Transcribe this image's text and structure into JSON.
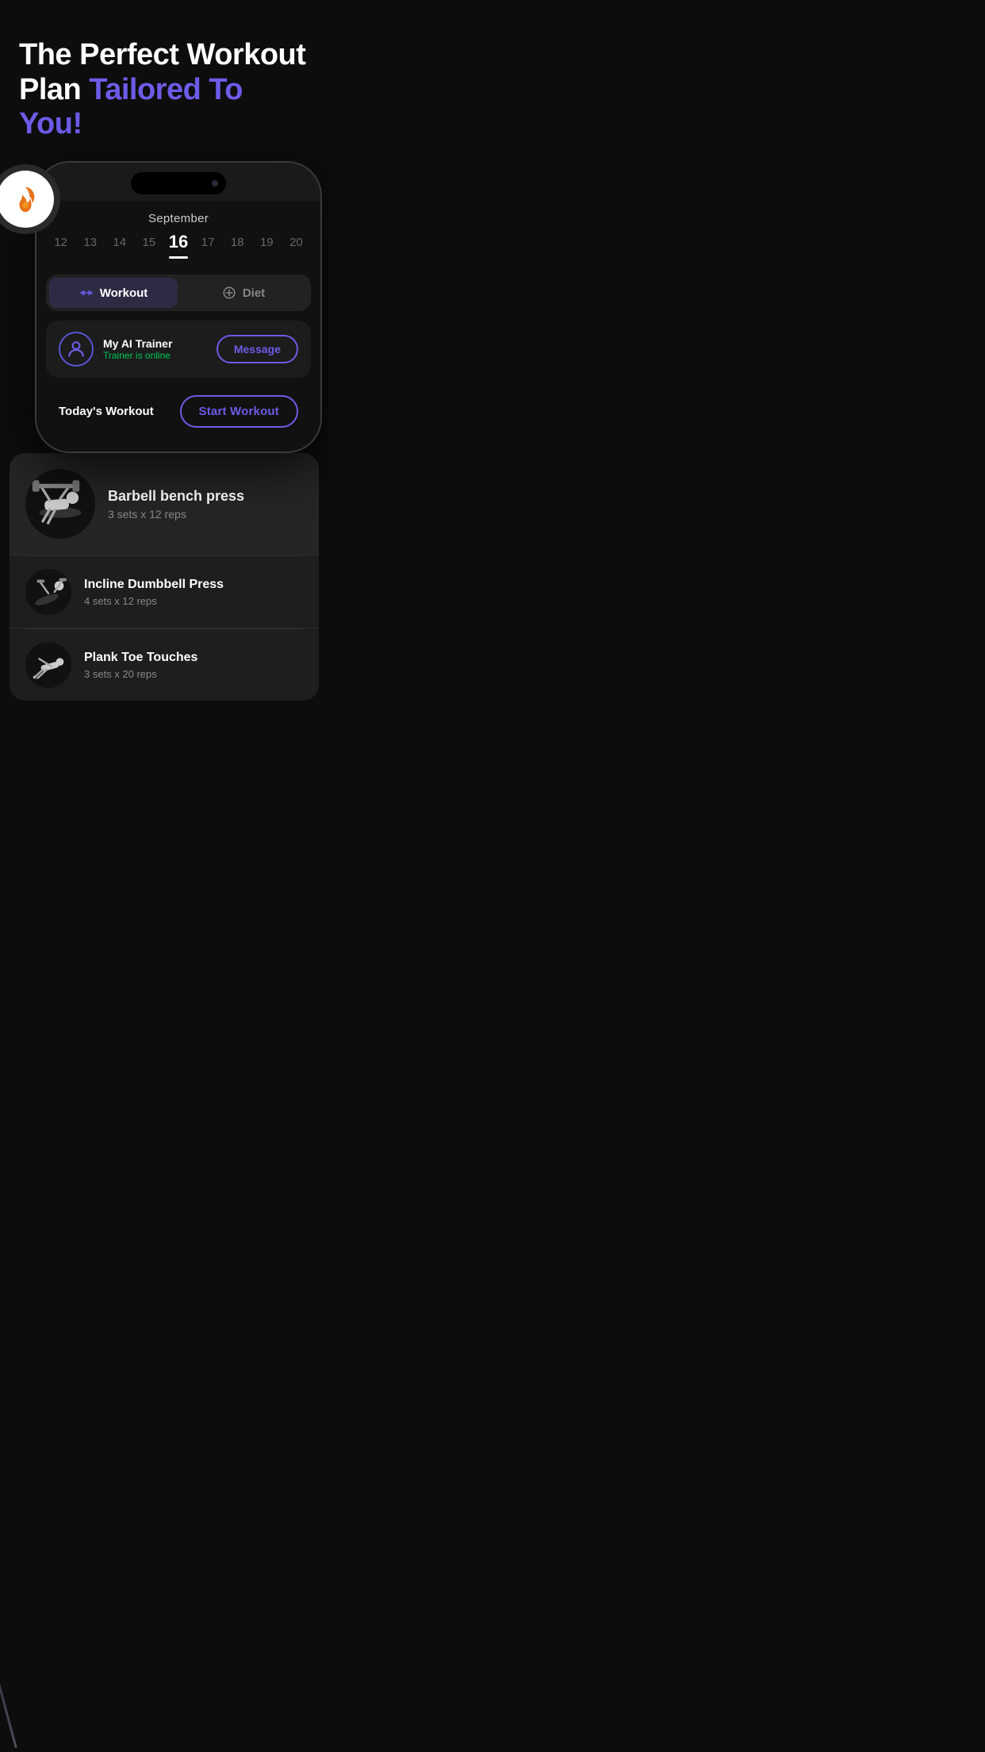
{
  "hero": {
    "title_line1": "The Perfect Workout",
    "title_line2_white": "Plan ",
    "title_line2_accent": "Tailored To You!"
  },
  "calendar": {
    "month": "September",
    "dates": [
      {
        "num": "12",
        "active": false
      },
      {
        "num": "13",
        "active": false
      },
      {
        "num": "14",
        "active": false
      },
      {
        "num": "15",
        "active": false
      },
      {
        "num": "16",
        "active": true
      },
      {
        "num": "17",
        "active": false
      },
      {
        "num": "18",
        "active": false
      },
      {
        "num": "19",
        "active": false
      },
      {
        "num": "20",
        "active": false
      }
    ]
  },
  "tabs": {
    "workout_label": "Workout",
    "diet_label": "Diet"
  },
  "trainer": {
    "name": "My AI Trainer",
    "status": "Trainer is online",
    "message_btn": "Message"
  },
  "workout": {
    "todays_label": "Today's Workout",
    "start_btn": "Start Workout"
  },
  "exercises": [
    {
      "name": "Barbell bench press",
      "sets": "3 sets x 12 reps",
      "featured": true
    },
    {
      "name": "Incline Dumbbell Press",
      "sets": "4 sets x 12 reps",
      "featured": false
    },
    {
      "name": "Plank Toe Touches",
      "sets": "3 sets x 20 reps",
      "featured": false
    }
  ],
  "colors": {
    "accent": "#6c5ce7",
    "online": "#00c853",
    "background": "#0d0d0d",
    "card": "#1e1e1e"
  }
}
